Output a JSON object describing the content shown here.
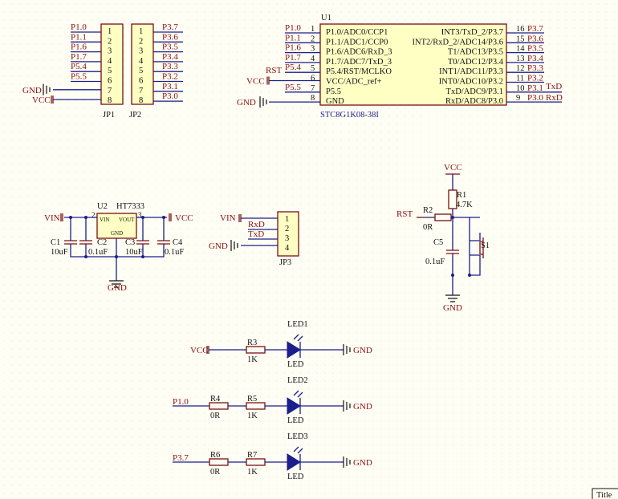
{
  "jp1": {
    "designator": "JP1",
    "pin_numbers": [
      "1",
      "2",
      "3",
      "4",
      "5",
      "6",
      "7",
      "8"
    ],
    "nets": [
      "P1.0",
      "P1.1",
      "P1.6",
      "P1.7",
      "P5.4",
      "P5.5",
      "GND",
      "VCC"
    ]
  },
  "jp2": {
    "designator": "JP2",
    "pin_numbers": [
      "1",
      "2",
      "3",
      "4",
      "5",
      "6",
      "7",
      "8"
    ],
    "nets": [
      "P3.7",
      "P3.6",
      "P3.5",
      "P3.4",
      "P3.3",
      "P3.2",
      "P3.1",
      "P3.0"
    ]
  },
  "u1": {
    "designator": "U1",
    "part": "STC8G1K08-38I",
    "left_pins": [
      {
        "num": "1",
        "name": "P1.0/ADC0/CCP1",
        "net": "P1.0"
      },
      {
        "num": "2",
        "name": "P1.1/ADC1/CCP0",
        "net": "P1.1"
      },
      {
        "num": "3",
        "name": "P1.6/ADC6/RxD_3",
        "net": "P1.6"
      },
      {
        "num": "4",
        "name": "P1.7/ADC7/TxD_3",
        "net": "P1.7"
      },
      {
        "num": "5",
        "name": "P5.4/RST/MCLKO",
        "net": "P5.4"
      },
      {
        "num": "6",
        "name": "VCC/ADC_ref+",
        "net": "VCC"
      },
      {
        "num": "7",
        "name": "P5.5",
        "net": "P5.5"
      },
      {
        "num": "8",
        "name": "GND",
        "net": "GND"
      }
    ],
    "right_pins": [
      {
        "num": "16",
        "name": "INT3/TxD_2/P3.7",
        "net": "P3.7"
      },
      {
        "num": "15",
        "name": "INT2/RxD_2/ADC14/P3.6",
        "net": "P3.6"
      },
      {
        "num": "14",
        "name": "T1/ADC13/P3.5",
        "net": "P3.5"
      },
      {
        "num": "13",
        "name": "T0/ADC12/P3.4",
        "net": "P3.4"
      },
      {
        "num": "12",
        "name": "INT1/ADC11/P3.3",
        "net": "P3.3"
      },
      {
        "num": "11",
        "name": "INT0/ADC10/P3.2",
        "net": "P3.2"
      },
      {
        "num": "10",
        "name": "TxD/ADC9/P3.1",
        "net": "P3.1"
      },
      {
        "num": "9",
        "name": "RxD/ADC8/P3.0",
        "net": "P3.0"
      }
    ],
    "rst_net": "RST",
    "txd_net": "TxD",
    "rxd_net": "RxD"
  },
  "regulator": {
    "designator": "U2",
    "part": "HT7333",
    "pin_vin_num": "2",
    "pin_vout_num": "3",
    "pin_vin": "VIN",
    "pin_vout": "VOUT",
    "pin_gnd": "GND",
    "in_net": "VIN",
    "out_net": "VCC",
    "gnd_net": "GND",
    "c1": {
      "designator": "C1",
      "value": "10uF"
    },
    "c2": {
      "designator": "C2",
      "value": "0.1uF"
    },
    "c3": {
      "designator": "C3",
      "value": "10uF"
    },
    "c4": {
      "designator": "C4",
      "value": "0.1uF"
    }
  },
  "jp3": {
    "designator": "JP3",
    "pin_numbers": [
      "1",
      "2",
      "3",
      "4"
    ],
    "nets": [
      "VIN",
      "RxD",
      "TxD",
      "GND"
    ]
  },
  "reset": {
    "vcc_net": "VCC",
    "rst_net": "RST",
    "gnd_net": "GND",
    "r1": {
      "designator": "R1",
      "value": "4.7K"
    },
    "r2": {
      "designator": "R2",
      "value": "0R"
    },
    "c5": {
      "designator": "C5",
      "value": "0.1uF"
    },
    "s1": {
      "designator": "S1"
    }
  },
  "leds": [
    {
      "source": "VCC",
      "r_a": null,
      "r_b": {
        "designator": "R3",
        "value": "1K"
      },
      "led": "LED1",
      "led_value": "LED",
      "gnd": "GND"
    },
    {
      "source": "P1.0",
      "r_a": {
        "designator": "R4",
        "value": "0R"
      },
      "r_b": {
        "designator": "R5",
        "value": "1K"
      },
      "led": "LED2",
      "led_value": "LED",
      "gnd": "GND"
    },
    {
      "source": "P3.7",
      "r_a": {
        "designator": "R6",
        "value": "0R"
      },
      "r_b": {
        "designator": "R7",
        "value": "1K"
      },
      "led": "LED3",
      "led_value": "LED",
      "gnd": "GND"
    }
  ],
  "title_block": {
    "label": "Title"
  },
  "colors": {
    "wire": "#1a1f8c",
    "component": "#7a1010",
    "net_label": "#8a0e0e",
    "chip_fill": "#ffffc4",
    "background": "#fffef4"
  }
}
